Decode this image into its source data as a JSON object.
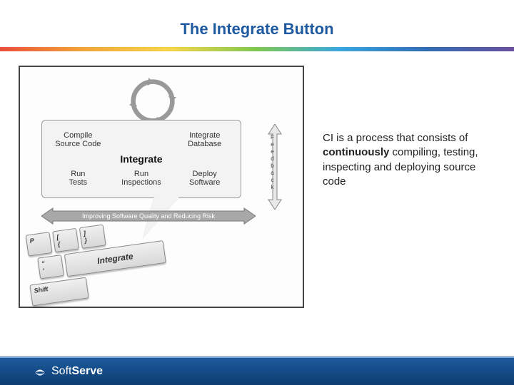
{
  "title": "The Integrate Button",
  "callout": {
    "title": "Integrate",
    "items": {
      "top_left": "Compile\nSource Code",
      "top_right": "Integrate\nDatabase",
      "bottom_left": "Run\nTests",
      "bottom_mid": "Run\nInspections",
      "bottom_right": "Deploy\nSoftware"
    }
  },
  "feedback_label": "Feedback",
  "quality_label": "Improving Software Quality and Reducing Risk",
  "keyboard": {
    "p": "P",
    "brackets_l": "[\n{",
    "brackets_r": "]\n}",
    "quote": "\"\n'",
    "integrate": "Integrate",
    "shift": "Shift"
  },
  "description": {
    "prefix": "CI is a process that consists of ",
    "bold": "continuously",
    "suffix": " compiling, testing, inspecting and deploying source code"
  },
  "footer": {
    "brand1": "Soft",
    "brand2": "Serve"
  }
}
